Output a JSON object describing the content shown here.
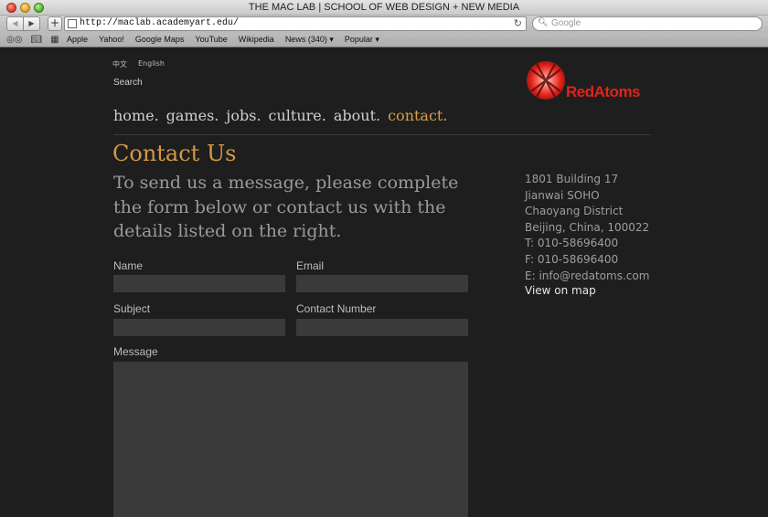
{
  "window": {
    "title": "THE MAC LAB | SCHOOL OF WEB DESIGN + NEW MEDIA"
  },
  "toolbar": {
    "back_icon": "back-arrow-icon",
    "forward_icon": "forward-arrow-icon",
    "add_label": "+",
    "url": "http://maclab.academyart.edu/",
    "reload_glyph": "↻",
    "search_placeholder": "Google"
  },
  "bookmarks": {
    "items": [
      "Apple",
      "Yahoo!",
      "Google Maps",
      "YouTube",
      "Wikipedia",
      "News (340) ▾",
      "Popular ▾"
    ]
  },
  "header": {
    "lang_chinese": "中文",
    "lang_english": "English",
    "search_link": "Search",
    "logo_text": "RedAtoms",
    "logo_color": "#e2231a"
  },
  "nav": {
    "items": [
      "home.",
      "games.",
      "jobs.",
      "culture.",
      "about.",
      "contact."
    ],
    "active_color": "#d7a046"
  },
  "main": {
    "heading": "Contact Us",
    "intro": "To send us a message, please complete the form below or contact us with the details listed on the right."
  },
  "form": {
    "name_label": "Name",
    "email_label": "Email",
    "subject_label": "Subject",
    "contact_number_label": "Contact Number",
    "message_label": "Message"
  },
  "contact": {
    "lines": [
      "1801 Building 17",
      "Jianwai SOHO",
      "Chaoyang District",
      "Beijing, China, 100022",
      "T: 010-58696400",
      "F: 010-58696400",
      "E: info@redatoms.com"
    ],
    "map_link": "View on map"
  }
}
